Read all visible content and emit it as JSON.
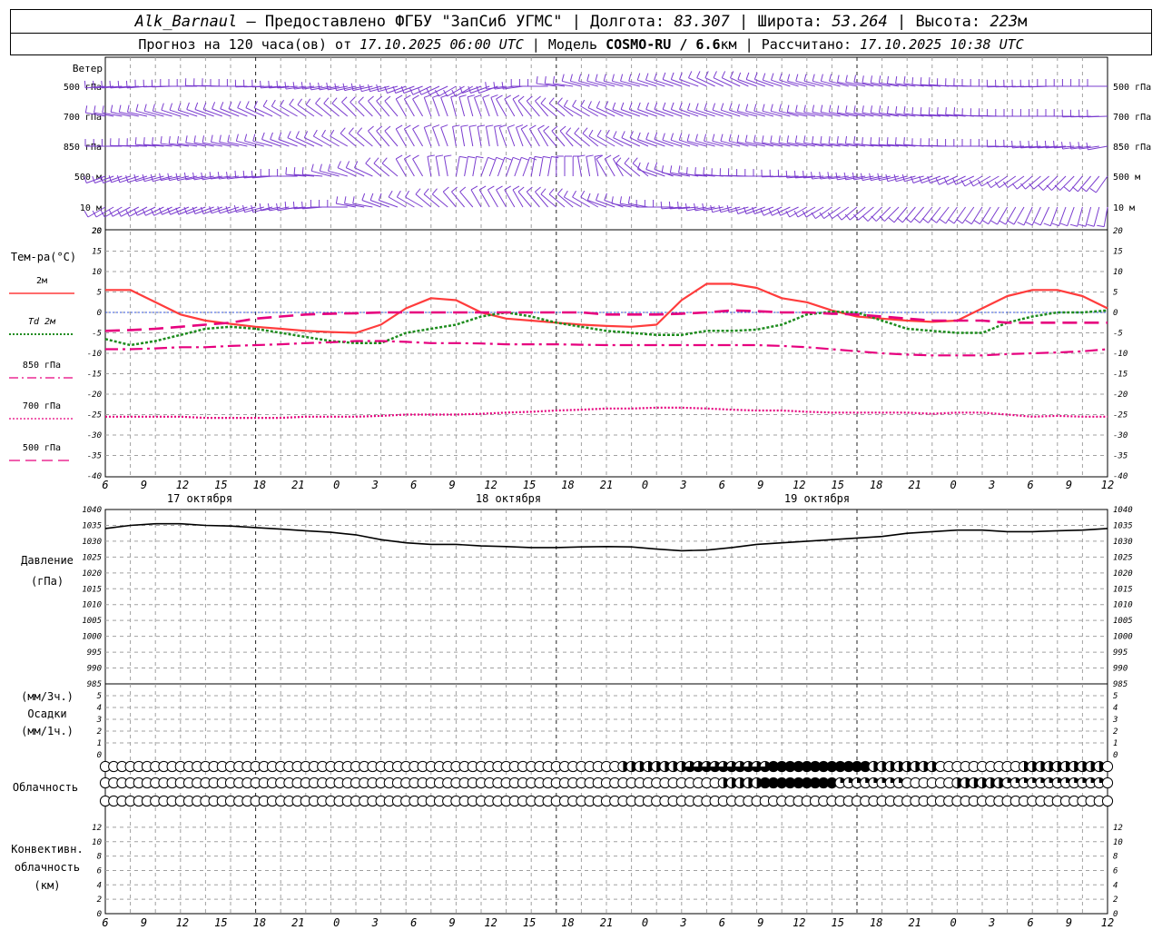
{
  "header": {
    "station": "Alk_Barnaul",
    "provided": "– Предоставлено ФГБУ \"ЗапСиб УГМС\"",
    "lon_label": "Долгота:",
    "lon": "83.307",
    "lat_label": "Широта:",
    "lat": "53.264",
    "alt_label": "Высота:",
    "alt": "223",
    "alt_unit": "м",
    "forecast_label": "Прогноз на 120 часа(ов) от",
    "forecast_from": "17.10.2025 06:00 UTC",
    "model_label": "Модель",
    "model": "COSMO-RU / 6.6",
    "model_unit": "км",
    "calc_label": "Рассчитано:",
    "calc_time": "17.10.2025 10:38 UTC"
  },
  "labels": {
    "wind": "Ветер",
    "wind_levels": [
      "500 гПа",
      "700 гПа",
      "850 гПа",
      "500 м",
      "10 м"
    ],
    "temp": "Тем-ра(°С)",
    "legend": [
      {
        "name": "2м",
        "color": "#ff3c3c",
        "style": "solid"
      },
      {
        "name": "Td 2м",
        "color": "#1e8c1e",
        "style": "dotted"
      },
      {
        "name": "850 гПа",
        "color": "#e6007e",
        "style": "dashdot"
      },
      {
        "name": "700 гПа",
        "color": "#e6007e",
        "style": "dotted"
      },
      {
        "name": "500 гПа",
        "color": "#e6007e",
        "style": "dashed"
      }
    ],
    "pressure": [
      "Давление",
      "(гПа)"
    ],
    "precip": [
      "(мм/3ч.)",
      "Осадки",
      "(мм/1ч.)"
    ],
    "cloud": "Облачность",
    "conv": [
      "Конвективн.",
      "облачность",
      "(км)"
    ]
  },
  "time_ticks": [
    "6",
    "9",
    "12",
    "15",
    "18",
    "21",
    "0",
    "3",
    "6",
    "9",
    "12",
    "15",
    "18",
    "21",
    "0",
    "3",
    "6",
    "9",
    "12",
    "15",
    "18",
    "21",
    "0",
    "3",
    "6",
    "9",
    "12"
  ],
  "dates": [
    "17 октября",
    "18 октября",
    "19 октября"
  ],
  "colors": {
    "wind": "#7a3ccf",
    "t2m": "#ff3c3c",
    "td2m": "#1e8c1e",
    "levels": "#e6007e",
    "grid": "#a0a0a0"
  },
  "chart_data": [
    {
      "type": "line",
      "title": "Тем-ра(°С)",
      "x_hours": [
        0,
        3,
        6,
        9,
        12,
        15,
        18,
        21,
        24,
        27,
        30,
        33,
        36,
        39,
        42,
        45,
        48,
        51,
        54,
        57,
        60,
        63,
        66,
        69,
        72,
        75,
        78,
        81,
        84,
        87,
        90,
        93,
        96,
        99,
        102,
        105,
        108,
        111,
        114,
        117,
        120
      ],
      "ylim": [
        -40,
        20
      ],
      "yticks": [
        20,
        15,
        10,
        5,
        0,
        -5,
        -10,
        -15,
        -20,
        -25,
        -30,
        -35,
        -40
      ],
      "series": [
        {
          "name": "2м",
          "values": [
            5.5,
            5.5,
            2.5,
            -0.5,
            -2,
            -2.8,
            -3.5,
            -4,
            -4.5,
            -4.8,
            -5,
            -3,
            1,
            3.5,
            3,
            0,
            -1.5,
            -2,
            -2.5,
            -3,
            -3.3,
            -3.5,
            -3,
            3,
            7,
            7,
            6,
            3.5,
            2.5,
            0.5,
            -1,
            -1.5,
            -2,
            -2.3,
            -2,
            1,
            4,
            5.5,
            5.5,
            4,
            1
          ]
        },
        {
          "name": "Td 2м",
          "values": [
            -6.5,
            -8,
            -7,
            -5.5,
            -4,
            -3.5,
            -4,
            -5,
            -6,
            -7,
            -7.5,
            -7.5,
            -5,
            -4,
            -3,
            -1,
            0,
            -1,
            -2.5,
            -3.5,
            -4.5,
            -5,
            -5.5,
            -5.5,
            -4.5,
            -4.5,
            -4.2,
            -3,
            -0.5,
            0.2,
            0,
            -2,
            -4,
            -4.5,
            -5,
            -5,
            -2.5,
            -1,
            0,
            0,
            0.5
          ]
        },
        {
          "name": "850 гПа",
          "values": [
            -9,
            -9,
            -8.8,
            -8.5,
            -8.5,
            -8.2,
            -8,
            -7.8,
            -7.5,
            -7.3,
            -7,
            -7,
            -7.2,
            -7.5,
            -7.5,
            -7.6,
            -7.8,
            -7.8,
            -7.8,
            -7.9,
            -8,
            -8,
            -8,
            -8,
            -8,
            -8,
            -8,
            -8.2,
            -8.5,
            -9,
            -9.5,
            -10,
            -10.3,
            -10.5,
            -10.5,
            -10.5,
            -10.2,
            -10,
            -9.8,
            -9.5,
            -9
          ]
        },
        {
          "name": "700 гПа",
          "values": [
            -25.5,
            -25.5,
            -25.5,
            -25.5,
            -25.8,
            -25.8,
            -25.8,
            -25.8,
            -25.5,
            -25.5,
            -25.5,
            -25.3,
            -25,
            -25,
            -25,
            -24.8,
            -24.5,
            -24.3,
            -24,
            -23.8,
            -23.5,
            -23.5,
            -23.3,
            -23.3,
            -23.5,
            -23.8,
            -24,
            -24,
            -24.3,
            -24.5,
            -24.5,
            -24.5,
            -24.5,
            -24.8,
            -24.5,
            -24.5,
            -25,
            -25.5,
            -25.3,
            -25.5,
            -25.5
          ]
        },
        {
          "name": "500 гПа",
          "values": [
            -4.5,
            -4.3,
            -4,
            -3.5,
            -3,
            -2.5,
            -1.5,
            -1,
            -0.5,
            -0.3,
            -0.2,
            0,
            0,
            0,
            0,
            0,
            0,
            0,
            0,
            0,
            -0.5,
            -0.5,
            -0.5,
            -0.3,
            0,
            0.5,
            0.3,
            0,
            0,
            -0.3,
            -0.5,
            -1,
            -1.5,
            -2,
            -2,
            -2,
            -2.5,
            -2.5,
            -2.5,
            -2.5,
            -2.5
          ]
        }
      ]
    },
    {
      "type": "line",
      "title": "Давление (гПа)",
      "x_hours": [
        0,
        3,
        6,
        9,
        12,
        15,
        18,
        21,
        24,
        27,
        30,
        33,
        36,
        39,
        42,
        45,
        48,
        51,
        54,
        57,
        60,
        63,
        66,
        69,
        72,
        75,
        78,
        81,
        84,
        87,
        90,
        93,
        96,
        99,
        102,
        105,
        108,
        111,
        114,
        117,
        120
      ],
      "ylim": [
        985,
        1040
      ],
      "yticks": [
        1040,
        1035,
        1030,
        1025,
        1020,
        1015,
        1010,
        1005,
        1000,
        995,
        990,
        985
      ],
      "series": [
        {
          "name": "Давление",
          "values": [
            1034,
            1035,
            1035.5,
            1035.5,
            1035,
            1034.8,
            1034.3,
            1033.8,
            1033.3,
            1032.8,
            1032,
            1030.5,
            1029.5,
            1029,
            1029,
            1028.5,
            1028.3,
            1028,
            1028,
            1028.2,
            1028.3,
            1028.2,
            1027.5,
            1027,
            1027.2,
            1028,
            1029,
            1029.5,
            1030,
            1030.5,
            1031,
            1031.5,
            1032.5,
            1033,
            1033.5,
            1033.5,
            1033,
            1033,
            1033.3,
            1033.5,
            1034
          ]
        }
      ]
    },
    {
      "type": "bar",
      "title": "Осадки",
      "ylim": [
        0,
        5
      ],
      "yticks": [
        5,
        4,
        3,
        2,
        1,
        0
      ],
      "values": []
    },
    {
      "type": "scatter",
      "title": "Облачность",
      "note_scale": "0-4 quarter circles",
      "x_hours_step": 1,
      "rows": [
        {
          "name": "high",
          "segments": [
            [
              0,
              0,
              0
            ],
            [
              62,
              70,
              2
            ],
            [
              70,
              80,
              3
            ],
            [
              80,
              92,
              4
            ],
            [
              92,
              100,
              2
            ],
            [
              100,
              110,
              0
            ],
            [
              110,
              120,
              2
            ]
          ]
        },
        {
          "name": "mid",
          "segments": [
            [
              0,
              0,
              0
            ],
            [
              74,
              79,
              2
            ],
            [
              79,
              88,
              4
            ],
            [
              88,
              96,
              1
            ],
            [
              96,
              102,
              0
            ],
            [
              102,
              108,
              2
            ],
            [
              108,
              120,
              1
            ]
          ]
        },
        {
          "name": "low",
          "segments": [
            [
              0,
              0,
              0
            ]
          ]
        }
      ]
    },
    {
      "type": "bar",
      "title": "Конвективн. облачность (км)",
      "ylim": [
        0,
        13
      ],
      "yticks": [
        12,
        10,
        8,
        6,
        4,
        2,
        0
      ],
      "values": []
    }
  ],
  "wind_barbs": {
    "note": "direction in degrees (from), speed in knots per level, every 3h",
    "levels": [
      {
        "name": "500 гПа",
        "dir": [
          265,
          265,
          268,
          270,
          272,
          270,
          268,
          265,
          262,
          260,
          258,
          255,
          250,
          245,
          240,
          250,
          262,
          270,
          278,
          285,
          285,
          285,
          288,
          290,
          295,
          295,
          290,
          288,
          285,
          285,
          282,
          280,
          278,
          275,
          272,
          270,
          268,
          268,
          270,
          270,
          270
        ],
        "spd": [
          35,
          35,
          35,
          35,
          35,
          35,
          35,
          35,
          35,
          30,
          30,
          30,
          30,
          30,
          35,
          40,
          40,
          35,
          30,
          30,
          30,
          30,
          30,
          30,
          30,
          30,
          30,
          30,
          30,
          30,
          30,
          30,
          30,
          30,
          30,
          30,
          30,
          30,
          30,
          30,
          30
        ]
      },
      {
        "name": "700 гПа",
        "dir": [
          280,
          282,
          285,
          288,
          290,
          292,
          295,
          300,
          305,
          310,
          315,
          320,
          330,
          340,
          345,
          340,
          330,
          320,
          310,
          300,
          295,
          290,
          290,
          290,
          288,
          288,
          285,
          285,
          282,
          282,
          280,
          280,
          278,
          275,
          275,
          272,
          270,
          270,
          270,
          268,
          268
        ],
        "spd": [
          25,
          25,
          25,
          25,
          25,
          25,
          25,
          25,
          25,
          25,
          25,
          25,
          25,
          25,
          25,
          25,
          25,
          25,
          25,
          25,
          25,
          25,
          25,
          25,
          25,
          25,
          25,
          25,
          25,
          25,
          25,
          25,
          25,
          25,
          25,
          25,
          25,
          25,
          25,
          25,
          25
        ]
      },
      {
        "name": "850 гПа",
        "dir": [
          270,
          272,
          275,
          278,
          280,
          282,
          285,
          290,
          295,
          300,
          310,
          320,
          330,
          340,
          350,
          350,
          340,
          330,
          320,
          310,
          300,
          295,
          290,
          288,
          285,
          285,
          282,
          280,
          280,
          278,
          278,
          275,
          275,
          272,
          270,
          270,
          268,
          265,
          265,
          262,
          260
        ],
        "spd": [
          20,
          20,
          20,
          20,
          20,
          20,
          20,
          20,
          20,
          20,
          20,
          20,
          20,
          20,
          20,
          20,
          20,
          20,
          20,
          20,
          20,
          20,
          20,
          20,
          20,
          20,
          20,
          20,
          20,
          20,
          20,
          20,
          20,
          20,
          20,
          20,
          20,
          20,
          20,
          20,
          20
        ]
      },
      {
        "name": "500 м",
        "dir": [
          250,
          252,
          255,
          258,
          260,
          262,
          265,
          270,
          275,
          285,
          295,
          310,
          330,
          350,
          10,
          20,
          20,
          10,
          0,
          350,
          330,
          310,
          290,
          280,
          275,
          272,
          270,
          268,
          265,
          262,
          260,
          258,
          255,
          250,
          245,
          240,
          235,
          230,
          225,
          220,
          215
        ],
        "spd": [
          15,
          15,
          15,
          15,
          15,
          15,
          15,
          15,
          15,
          15,
          15,
          15,
          15,
          15,
          15,
          15,
          15,
          15,
          15,
          15,
          15,
          15,
          15,
          15,
          15,
          15,
          15,
          15,
          15,
          15,
          15,
          15,
          15,
          15,
          15,
          15,
          15,
          15,
          15,
          15,
          15
        ]
      },
      {
        "name": "10 м",
        "dir": [
          240,
          242,
          245,
          248,
          250,
          252,
          255,
          260,
          265,
          270,
          280,
          290,
          300,
          310,
          320,
          330,
          330,
          320,
          310,
          300,
          290,
          280,
          270,
          265,
          260,
          255,
          250,
          245,
          240,
          235,
          230,
          225,
          220,
          218,
          215,
          212,
          210,
          205,
          200,
          195,
          190
        ],
        "spd": [
          10,
          10,
          10,
          10,
          10,
          10,
          10,
          10,
          10,
          10,
          10,
          10,
          10,
          10,
          10,
          10,
          10,
          10,
          10,
          10,
          10,
          10,
          10,
          10,
          10,
          10,
          10,
          10,
          10,
          10,
          10,
          10,
          10,
          10,
          10,
          10,
          10,
          10,
          10,
          10,
          10
        ]
      }
    ]
  }
}
